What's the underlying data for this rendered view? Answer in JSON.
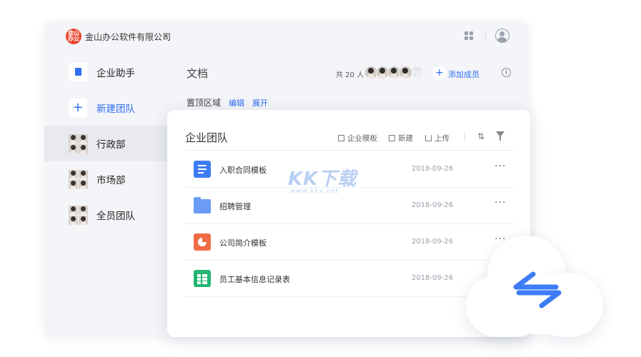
{
  "header": {
    "logo_text": "金山办公",
    "company": "金山办公软件有限公司",
    "caret": "▾"
  },
  "sidebar": {
    "items": [
      {
        "label": "企业助手"
      },
      {
        "label": "新建团队"
      },
      {
        "label": "行政部"
      },
      {
        "label": "市场部"
      },
      {
        "label": "全员团队"
      }
    ]
  },
  "main": {
    "title": "文档",
    "member_count": "共 20 人",
    "member_more": "···",
    "add_member": "添加成员",
    "info": "i",
    "pinned_label": "置顶区域",
    "pinned_edit": "编辑",
    "pinned_expand": "展开"
  },
  "panel": {
    "title": "企业团队",
    "toolbar": {
      "template": "企业模板",
      "new": "新建",
      "upload": "上传",
      "sort_glyph": "⇅"
    },
    "files": [
      {
        "name": "入职合同模板",
        "date": "2018-09-26",
        "more": "···",
        "type": "doc"
      },
      {
        "name": "招聘管理",
        "date": "2018-09-26",
        "more": "···",
        "type": "folder"
      },
      {
        "name": "公司简介模板",
        "date": "2018-09-26",
        "more": "···",
        "type": "presentation"
      },
      {
        "name": "员工基本信息记录表",
        "date": "2018-09-26",
        "more": "",
        "type": "spreadsheet"
      }
    ]
  },
  "watermark": {
    "text": "KK下载",
    "url": "www.kkx.net"
  },
  "colors": {
    "accent": "#2f6ef0",
    "logo": "#e8472f",
    "doc": "#3d7cf5",
    "folder": "#6a9cf5",
    "presentation": "#f06c45",
    "spreadsheet": "#22b573"
  }
}
